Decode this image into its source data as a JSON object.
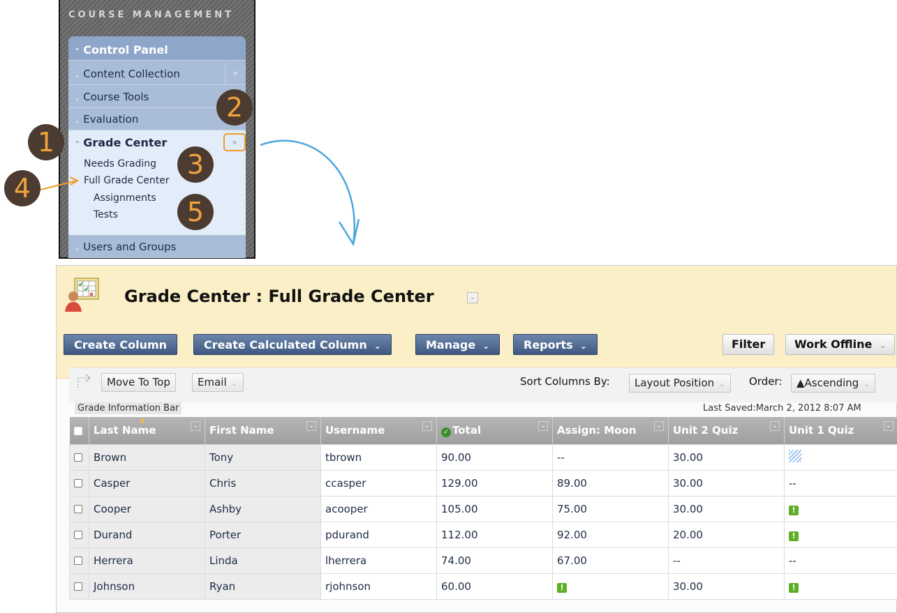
{
  "course_menu": {
    "title": "COURSE MANAGEMENT",
    "header": "Control Panel",
    "items": [
      "Content Collection",
      "Course Tools",
      "Evaluation",
      "Grade Center",
      "Users and Groups"
    ],
    "grade_center_links": [
      "Needs Grading",
      "Full Grade Center",
      "Assignments",
      "Tests"
    ],
    "callouts": [
      "1",
      "2",
      "3",
      "4",
      "5"
    ],
    "accent": "#f09a2c"
  },
  "page": {
    "title": "Grade Center : Full Grade Center"
  },
  "toolbar": {
    "create_column": "Create Column",
    "create_calculated": "Create Calculated Column",
    "manage": "Manage",
    "reports": "Reports",
    "filter": "Filter",
    "work_offline": "Work Offline"
  },
  "action_bar": {
    "move_to_top": "Move To Top",
    "email": "Email",
    "sort_by_label": "Sort Columns By:",
    "sort_by_value": "Layout Position",
    "order_label": "Order:",
    "order_value": "▲Ascending",
    "info_bar": "Grade Information Bar",
    "last_saved": "Last Saved:March 2, 2012 8:07 AM"
  },
  "grid": {
    "columns": [
      "Last Name",
      "First Name",
      "Username",
      "Total",
      "Assign: Moon",
      "Unit 2 Quiz",
      "Unit 1 Quiz"
    ],
    "rows": [
      [
        "Brown",
        "Tony",
        "tbrown",
        "90.00",
        "--",
        "30.00",
        "in-progress-icon"
      ],
      [
        "Casper",
        "Chris",
        "ccasper",
        "129.00",
        "89.00",
        "30.00",
        "--"
      ],
      [
        "Cooper",
        "Ashby",
        "acooper",
        "105.00",
        "75.00",
        "30.00",
        "needs-grading-icon"
      ],
      [
        "Durand",
        "Porter",
        "pdurand",
        "112.00",
        "92.00",
        "20.00",
        "needs-grading-icon"
      ],
      [
        "Herrera",
        "Linda",
        "lherrera",
        "74.00",
        "67.00",
        "--",
        "--"
      ],
      [
        "Johnson",
        "Ryan",
        "rjohnson",
        "60.00",
        "needs-grading-icon",
        "30.00",
        "needs-grading-icon"
      ]
    ]
  }
}
